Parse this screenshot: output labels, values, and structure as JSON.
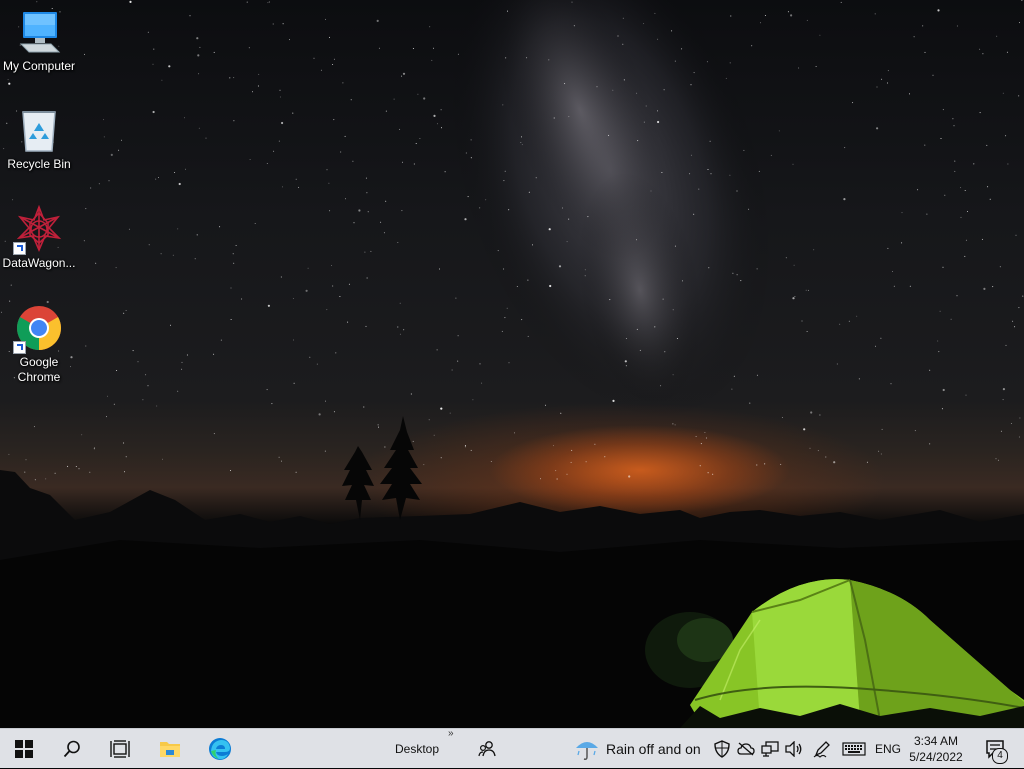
{
  "desktop": {
    "icons": [
      {
        "label": "My Computer",
        "icon": "computer-icon"
      },
      {
        "label": "Recycle Bin",
        "icon": "recycle-bin-icon"
      },
      {
        "label": "DataWagon...",
        "icon": "datawagon-icon"
      },
      {
        "label": "Google Chrome",
        "icon": "chrome-icon"
      }
    ]
  },
  "taskbar": {
    "start_icon": "windows-start-icon",
    "search_icon": "search-icon",
    "task_view_icon": "task-view-icon",
    "file_explorer_icon": "file-explorer-icon",
    "edge_icon": "edge-icon",
    "desktop_toolbar_label": "Desktop",
    "desktop_toolbar_chevron": "»",
    "people_icon": "people-icon",
    "weather": {
      "icon": "rain-umbrella-icon",
      "text": "Rain off and on"
    },
    "tray": [
      "security-shield-icon",
      "onedrive-offline-icon",
      "network-icon",
      "volume-icon",
      "pen-icon",
      "touch-keyboard-icon"
    ],
    "language": "ENG",
    "clock": {
      "time": "3:34 AM",
      "date": "5/24/2022"
    },
    "notifications": {
      "icon": "action-center-icon",
      "count": "4"
    }
  },
  "colors": {
    "taskbar_bg": "#dfe1e6",
    "tent_green": "#8fd12a",
    "horizon_orange": "#e8651e"
  }
}
